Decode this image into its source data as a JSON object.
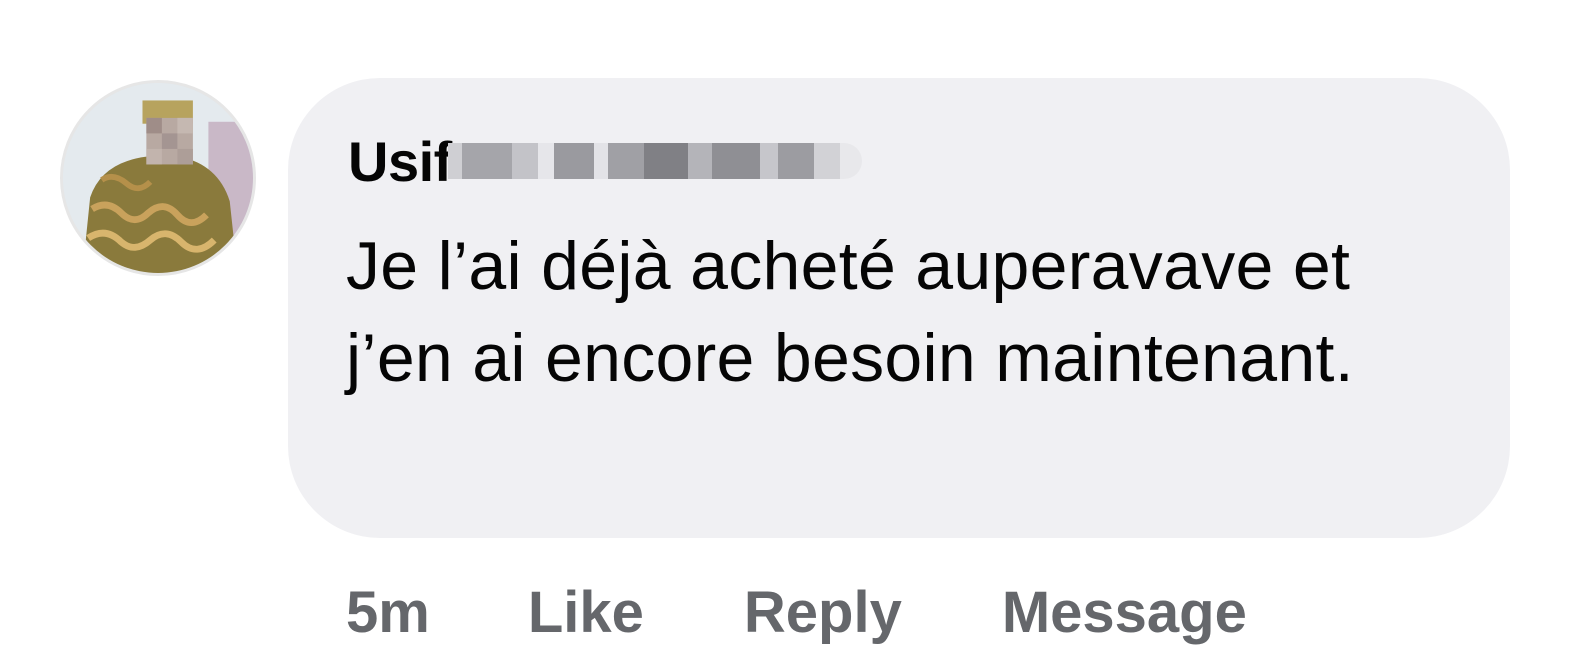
{
  "comment": {
    "author_visible": "Usif",
    "author_redacted": true,
    "text": "Je l’ai déjà acheté auperavave et j’en ai encore besoin maintenant.",
    "avatar_redacted_face": true
  },
  "actions": {
    "time": "5m",
    "like": "Like",
    "reply": "Reply",
    "message": "Message"
  },
  "colors": {
    "bubble": "#f0f0f3",
    "text": "#050505",
    "action_text": "#65676b"
  }
}
